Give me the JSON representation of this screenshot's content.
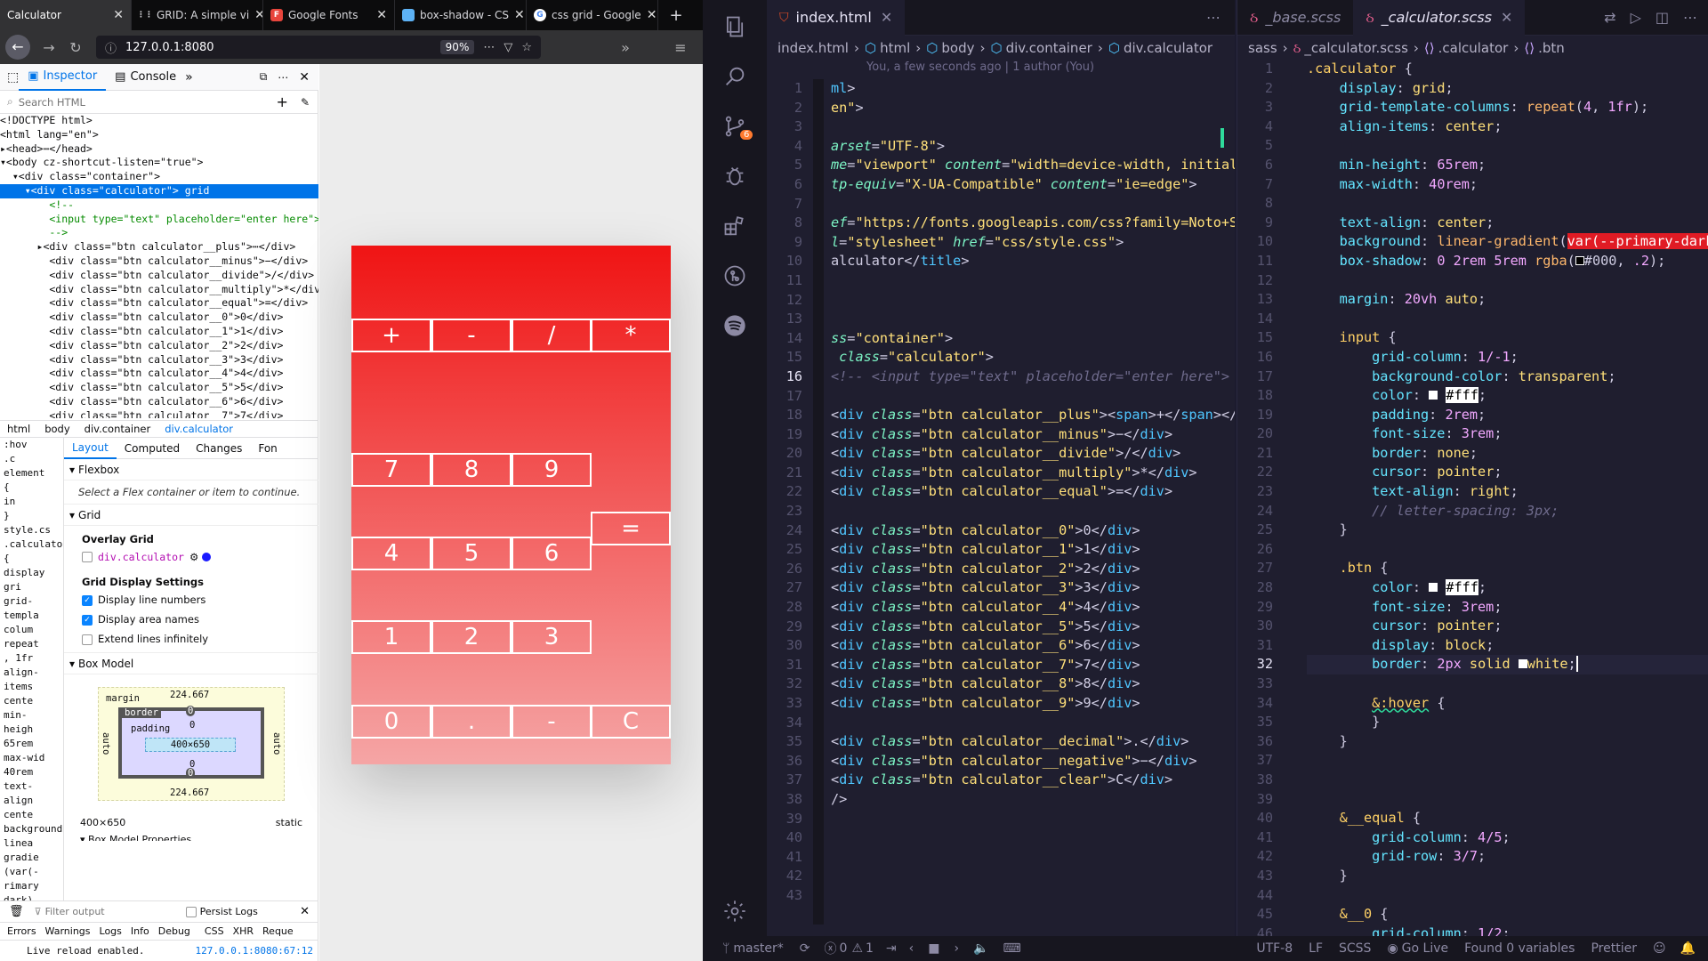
{
  "browser": {
    "tabs": [
      {
        "label": "Calculator",
        "active": true
      },
      {
        "label": "GRID: A simple vi",
        "active": false
      },
      {
        "label": "Google Fonts",
        "active": false
      },
      {
        "label": "box-shadow - CS",
        "active": false
      },
      {
        "label": "css grid - Google",
        "active": false
      }
    ],
    "url": "127.0.0.1:8080",
    "zoom": "90%"
  },
  "devtools": {
    "tabs": [
      "Inspector",
      "Console"
    ],
    "search_placeholder": "Search HTML",
    "tree": [
      "<!DOCTYPE html>",
      "<html lang=\"en\">",
      "▸<head>⋯</head>",
      "▾<body cz-shortcut-listen=\"true\">",
      "  ▾<div class=\"container\">",
      "    ▾<div class=\"calculator\"> grid",
      "        <!--",
      "        <input type=\"text\" placeholder=\"enter here\">",
      "        -->",
      "      ▸<div class=\"btn calculator__plus\">⋯</div>",
      "        <div class=\"btn calculator__minus\">−</div>",
      "        <div class=\"btn calculator__divide\">/</div>",
      "        <div class=\"btn calculator__multiply\">*</div>",
      "        <div class=\"btn calculator__equal\">=</div>",
      "        <div class=\"btn calculator__0\">0</div>",
      "        <div class=\"btn calculator__1\">1</div>",
      "        <div class=\"btn calculator__2\">2</div>",
      "        <div class=\"btn calculator__3\">3</div>",
      "        <div class=\"btn calculator__4\">4</div>",
      "        <div class=\"btn calculator__5\">5</div>",
      "        <div class=\"btn calculator__6\">6</div>",
      "        <div class=\"btn calculator__7\">7</div>"
    ],
    "breadcrumbs": [
      "html",
      "body",
      "div.container",
      "div.calculator"
    ],
    "rules_text": [
      ":hov",
      ".c",
      "element",
      "{",
      "in",
      "}",
      "style.cs",
      ".calculato",
      "{",
      "display",
      "gri",
      "grid-",
      "templa",
      "colum",
      "repeat",
      ", 1fr",
      "align-",
      "items",
      "cente",
      "min-",
      "heigh",
      "65rem",
      "max-wid",
      "40rem",
      "text-",
      "align",
      "cente",
      "",
      "background:",
      "linea",
      "gradie",
      "(var(-",
      "rimary",
      "dark),"
    ],
    "layout_tabs": [
      "Layout",
      "Computed",
      "Changes",
      "Fon"
    ],
    "flexbox_title": "Flexbox",
    "flexbox_note": "Select a Flex container or item to continue.",
    "grid_title": "Grid",
    "overlay_grid_label": "Overlay Grid",
    "overlay_item": "div.calculator",
    "grid_settings_label": "Grid Display Settings",
    "settings": [
      {
        "label": "Display line numbers",
        "checked": true
      },
      {
        "label": "Display area names",
        "checked": true
      },
      {
        "label": "Extend lines infinitely",
        "checked": false
      }
    ],
    "box_model_title": "Box Model",
    "box": {
      "margin_label": "margin",
      "border_label": "border",
      "padding_label": "padding",
      "margin_top": "224.667",
      "margin_bottom": "224.667",
      "margin_side": "auto",
      "border_val": "0",
      "padding_val": "0",
      "content": "400×650"
    },
    "size_readout": "400×650",
    "position_readout": "static",
    "box_model_props": "Box Model Properties",
    "filter_placeholder": "Filter output",
    "persist_logs": "Persist Logs",
    "console_filters": [
      "Errors",
      "Warnings",
      "Logs",
      "Info",
      "Debug",
      "CSS",
      "XHR",
      "Reque"
    ],
    "console_message": "Live reload enabled.",
    "console_source": "127.0.0.1:8080:67:12"
  },
  "calculator": {
    "operators": [
      "+",
      "-",
      "/",
      "*"
    ],
    "rows": [
      [
        "7",
        "8",
        "9"
      ],
      [
        "4",
        "5",
        "6"
      ],
      [
        "1",
        "2",
        "3"
      ]
    ],
    "equal": "=",
    "bottom": [
      "0",
      ".",
      "-",
      "C"
    ]
  },
  "vscode": {
    "left_tab": "index.html",
    "left_breadcrumb": [
      "index.html",
      "html",
      "body",
      "div.container",
      "div.calculator"
    ],
    "blame": "You, a few seconds ago | 1 author (You)",
    "right_tabs": [
      "_base.scss",
      "_calculator.scss"
    ],
    "right_breadcrumb": [
      "sass",
      "_calculator.scss",
      ".calculator",
      ".btn"
    ],
    "left_start_line": 1,
    "left_current_line": 16,
    "right_start_line": 1,
    "right_current_line": 32,
    "status": {
      "branch": "master*",
      "problems": "0",
      "warnings": "1",
      "encoding": "UTF-8",
      "eol": "LF",
      "language": "SCSS",
      "go_live": "Go Live",
      "variables": "Found 0 variables",
      "formatter": "Prettier"
    },
    "badge": "6"
  }
}
